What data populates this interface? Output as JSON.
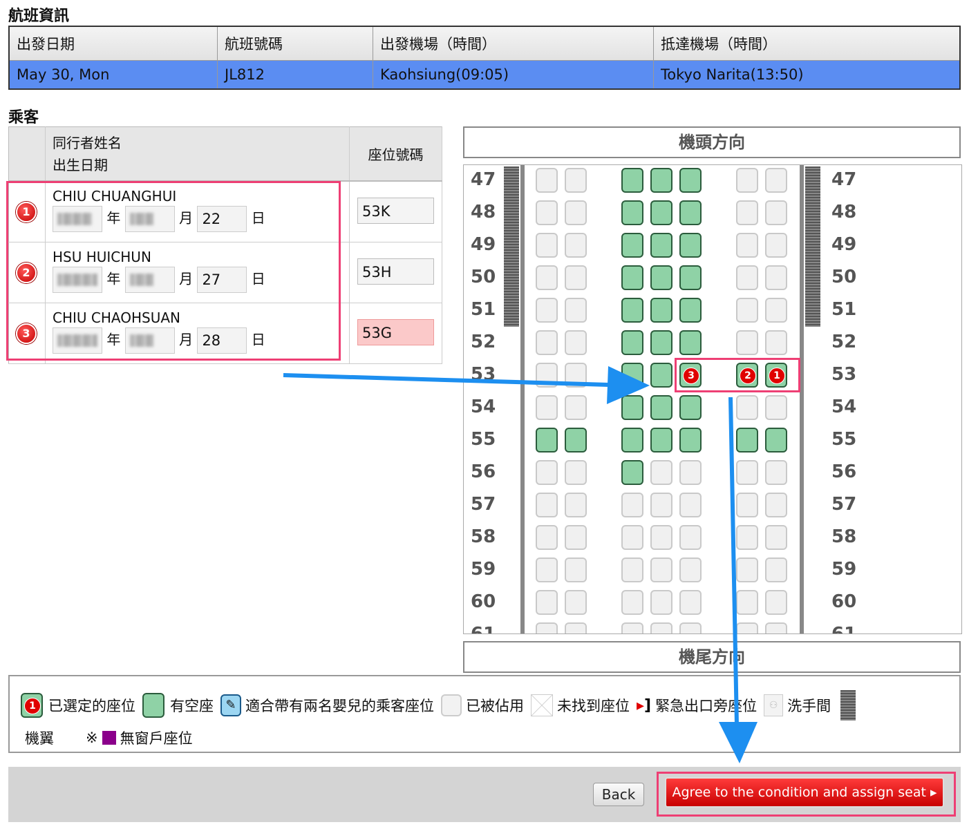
{
  "flight_section": {
    "title": "航班資訊",
    "headers": [
      "出發日期",
      "航班號碼",
      "出發機場（時間）",
      "抵達機場（時間）"
    ],
    "row": [
      "May 30, Mon",
      "JL812",
      "Kaohsiung(09:05)",
      "Tokyo Narita(13:50)"
    ]
  },
  "pax_section": {
    "title": "乘客",
    "header_name_line1": "同行者姓名",
    "header_name_line2": "出生日期",
    "header_seat": "座位號碼",
    "year_label": "年",
    "month_label": "月",
    "day_label": "日",
    "passengers": [
      {
        "badge": "1",
        "name": "CHIU CHUANGHUI",
        "day": "22",
        "seat": "53K",
        "highlight": false
      },
      {
        "badge": "2",
        "name": "HSU HUICHUN",
        "day": "27",
        "seat": "53H",
        "highlight": false
      },
      {
        "badge": "3",
        "name": "CHIU CHAOHSUAN",
        "day": "28",
        "seat": "53G",
        "highlight": true
      }
    ]
  },
  "seatmap": {
    "front_label": "機頭方向",
    "rear_label": "機尾方向",
    "rows": [
      "47",
      "48",
      "49",
      "50",
      "51",
      "52",
      "53",
      "54",
      "55",
      "56",
      "57",
      "58",
      "59",
      "60",
      "61"
    ]
  },
  "legend": {
    "selected": "已選定的座位",
    "available": "有空座",
    "bassinet": "適合帶有兩名嬰兒的乘客座位",
    "occupied": "已被佔用",
    "not_found": "未找到座位",
    "exit": "緊急出口旁座位",
    "lavatory": "洗手間",
    "wing": "機翼",
    "no_window_prefix": "※",
    "no_window": "無窗戶座位",
    "colors": {
      "selected": "#e00000",
      "available": "#8fd2a6",
      "no_window": "#8b008b"
    }
  },
  "footer": {
    "back": "Back",
    "agree": "Agree to the condition and assign seat ▸"
  }
}
